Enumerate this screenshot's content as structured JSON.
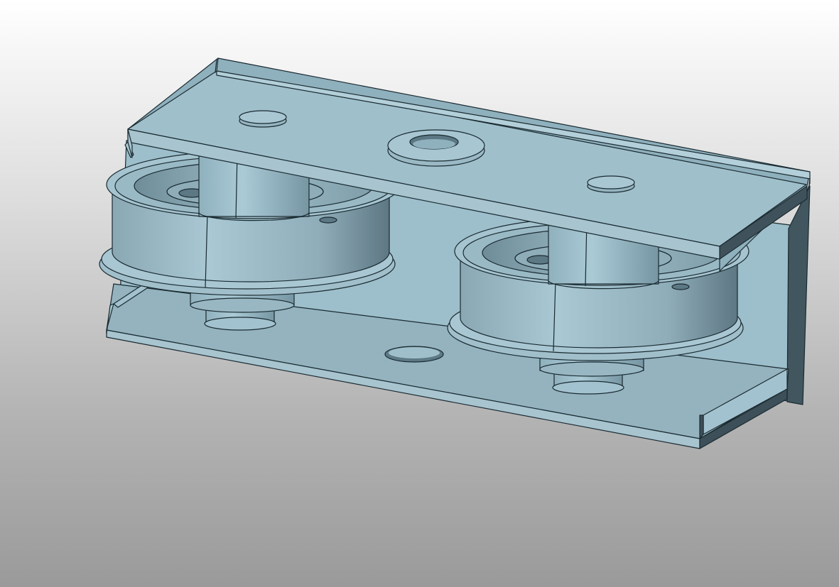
{
  "viewer": {
    "background": {
      "top": "#ffffff",
      "bottom": "#9a9a9a"
    },
    "model": {
      "description_icon": "cad-3d-model-icon",
      "part_color": "#a3c2cf",
      "edge_color": "#1a2a30",
      "shadow_color": "#3f525b",
      "components": [
        "top-plate",
        "bottom-plate",
        "back-plate",
        "left-pulley",
        "right-pulley",
        "mounting-holes"
      ]
    }
  }
}
